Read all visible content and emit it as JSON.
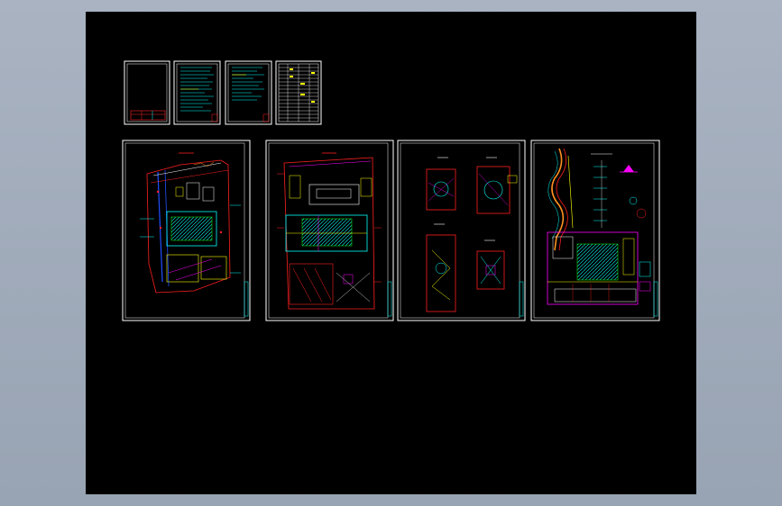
{
  "viewer": {
    "background": "#000000",
    "frame_color": "#a4aebd",
    "sheet_border_color": "#ffffff"
  },
  "palette": {
    "red": "#ff2020",
    "yellow": "#ffff00",
    "cyan": "#00ffff",
    "green": "#00ff00",
    "magenta": "#ff00ff",
    "blue": "#2050ff",
    "white": "#ffffff",
    "orange": "#ff9020"
  },
  "sheets": [
    {
      "id": "cover",
      "kind": "cover",
      "icon": "drawing-sheet-icon"
    },
    {
      "id": "notes-1",
      "kind": "notes",
      "icon": "drawing-sheet-icon"
    },
    {
      "id": "notes-2",
      "kind": "notes",
      "icon": "drawing-sheet-icon"
    },
    {
      "id": "schedule",
      "kind": "table",
      "icon": "drawing-sheet-icon"
    },
    {
      "id": "plan-1",
      "kind": "site-plan",
      "icon": "drawing-sheet-icon"
    },
    {
      "id": "plan-2",
      "kind": "floor-plan",
      "icon": "drawing-sheet-icon"
    },
    {
      "id": "details",
      "kind": "detail-plans",
      "icon": "drawing-sheet-icon"
    },
    {
      "id": "system",
      "kind": "system-diagram",
      "icon": "drawing-sheet-icon"
    }
  ]
}
